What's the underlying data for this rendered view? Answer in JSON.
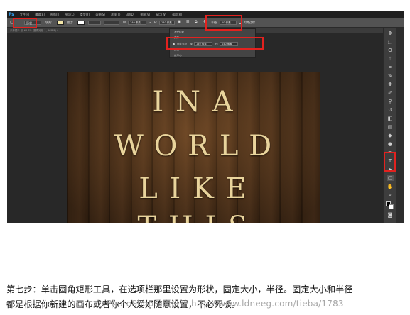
{
  "app": {
    "logo": "Ps",
    "menus": [
      "文件(F)",
      "编辑(E)",
      "图像(I)",
      "图层(L)",
      "类型(Y)",
      "选择(S)",
      "滤镜(T)",
      "3D(D)",
      "视图(V)",
      "窗口(W)",
      "帮助(H)"
    ]
  },
  "options": {
    "mode_value": "形状",
    "fill_label": "填充:",
    "stroke_label": "描边:",
    "width_label": "W:",
    "width_value": "140 像素",
    "height_label": "H:",
    "height_value": "140 像素",
    "radius_label": "半径:",
    "radius_value": "20 像素",
    "align_edges": "对齐边缘"
  },
  "document_tab": "未标题-1 @ 66.7% (圆角矩形 1, RGB/8) *",
  "dropdown": {
    "unconstrained": "不受约束",
    "square": "方形",
    "fixed_size": "固定大小",
    "w_label": "W:",
    "w_value": "140 像素",
    "h_label": "H:",
    "h_value": "140 像素",
    "proportional": "比例",
    "from_center": "从中心"
  },
  "canvas_text": {
    "line1": "I N A",
    "line2": "W O R L D",
    "line3": "L I K E",
    "line4": "T H I S"
  },
  "caption": {
    "line1": "第七步：单击圆角矩形工具，在选项栏那里设置为形状，固定大小，半径。固定大小和半径",
    "line2": "都是根据你新建的画布或者你个人爱好随意设置，不必死板。"
  },
  "watermark": "PhotoShop平面设计 http://www.ldneeg.com/tieba/1783",
  "colors": {
    "highlight": "#e2221f",
    "text_on_wood": "#e9d49c",
    "ps_accent": "#31a8ff"
  },
  "icons": [
    "move-icon",
    "marquee-icon",
    "lasso-icon",
    "magic-wand-icon",
    "crop-icon",
    "eyedropper-icon",
    "healing-icon",
    "brush-icon",
    "stamp-icon",
    "history-brush-icon",
    "eraser-icon",
    "gradient-icon",
    "blur-icon",
    "dodge-icon",
    "pen-icon",
    "type-icon",
    "path-selection-icon",
    "rounded-rectangle-icon",
    "hand-icon",
    "zoom-icon"
  ]
}
